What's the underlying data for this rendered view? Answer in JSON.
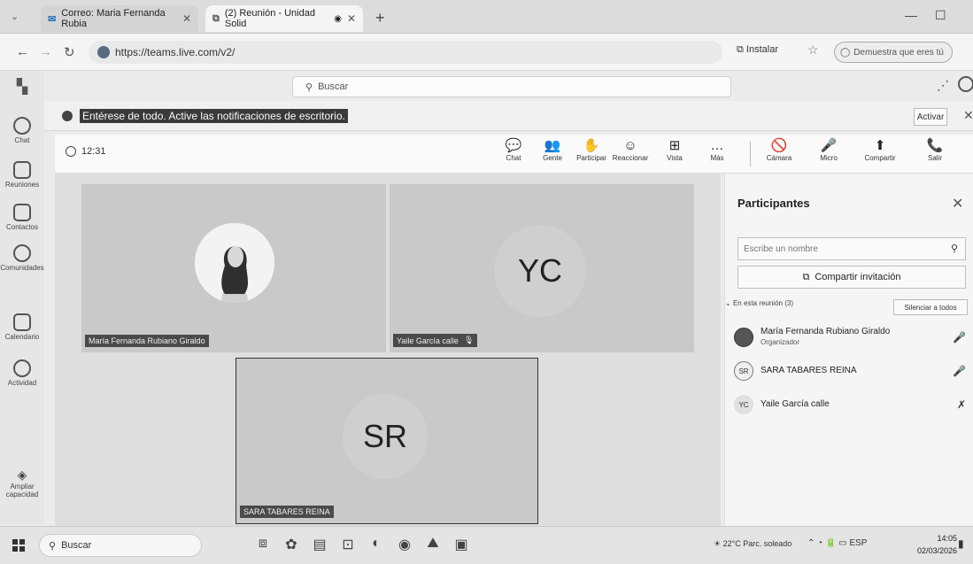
{
  "browser": {
    "tabs": [
      {
        "label": "Correo: Maria Fernanda Rubia"
      },
      {
        "label": "(2) Reunión - Unidad Solid"
      }
    ],
    "url": "https://teams.live.com/v2/",
    "install_label": "Instalar",
    "signin_label": "Demuestra que eres tú"
  },
  "teams": {
    "search_placeholder": "Buscar",
    "rail": [
      {
        "label": "Chat",
        "icon": "chat-icon"
      },
      {
        "label": "Reuniones",
        "icon": "video-icon"
      },
      {
        "label": "Contactos",
        "icon": "contacts-icon"
      },
      {
        "label": "Comunidades",
        "icon": "communities-icon"
      },
      {
        "label": "Calendario",
        "icon": "calendar-icon"
      },
      {
        "label": "Actividad",
        "icon": "bell-icon"
      }
    ],
    "rail_bottom": "Ampliar capacidad",
    "notification": {
      "text": "Entérese de todo. Active las notificaciones de escritorio.",
      "action": "Activar"
    }
  },
  "meeting": {
    "timer": "12:31",
    "tools": [
      {
        "label": "Chat",
        "glyph": "💬"
      },
      {
        "label": "Gente",
        "glyph": "👥"
      },
      {
        "label": "Participar",
        "glyph": "✋"
      },
      {
        "label": "Reaccionar",
        "glyph": "☺"
      },
      {
        "label": "Vista",
        "glyph": "⊞"
      },
      {
        "label": "Más",
        "glyph": "…"
      }
    ],
    "controls": [
      {
        "label": "Cámara",
        "glyph": "🚫"
      },
      {
        "label": "Micro",
        "glyph": "🎤"
      },
      {
        "label": "Compartir",
        "glyph": "⬆"
      },
      {
        "label": "Salir",
        "glyph": "📞"
      }
    ],
    "tiles": [
      {
        "name": "María Fernanda Rubiano Giraldo",
        "initials": ""
      },
      {
        "name": "Yaile García calle",
        "initials": "YC"
      },
      {
        "name": "SARA TABARES REINA",
        "initials": "SR"
      }
    ]
  },
  "participants": {
    "title": "Participantes",
    "search_placeholder": "Escribe un nombre",
    "invite_label": "Compartir invitación",
    "in_meeting_label": "En esta reunión (3)",
    "mute_all_label": "Silenciar a todos",
    "list": [
      {
        "name": "María Fernanda Rubiano Giraldo",
        "role": "Organizador",
        "initials": ""
      },
      {
        "name": "SARA TABARES REINA",
        "role": "",
        "initials": "SR"
      },
      {
        "name": "Yaile García calle",
        "role": "",
        "initials": "YC"
      }
    ]
  },
  "taskbar": {
    "search_placeholder": "Buscar",
    "weather": "22°C Parc. soleado",
    "lang": "ESP",
    "time": "14:05",
    "date": "02/03/2026"
  }
}
